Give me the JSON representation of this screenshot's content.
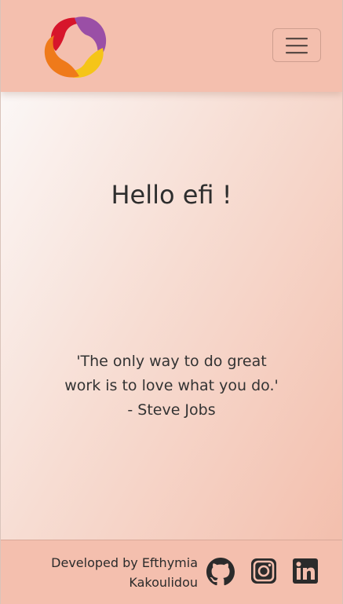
{
  "main": {
    "greeting": "Hello efi !",
    "quote_line_1": "'The only way to do great",
    "quote_line_2": "work is to love what you do.'",
    "quote_author": "- Steve Jobs"
  },
  "footer": {
    "credit_line_1": "Developed by Efthymia",
    "credit_line_2": "Kakoulidou",
    "social_icons": [
      "github-icon",
      "instagram-icon",
      "linkedin-icon"
    ]
  },
  "colors": {
    "nav_background": "#f4bfae",
    "logo_red": "#d7152b",
    "logo_purple": "#9a4fa6",
    "logo_orange": "#ef7a1a",
    "logo_yellow": "#f5c518",
    "icon_dark": "#2b2b2b"
  }
}
